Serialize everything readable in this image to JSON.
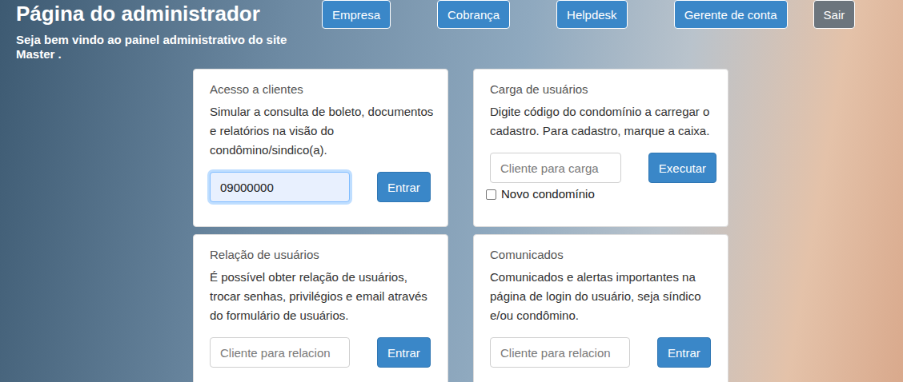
{
  "page": {
    "title": "Página do administrador",
    "subtitle": "Seja bem vindo ao painel administrativo do site Master ."
  },
  "nav": [
    {
      "label": "Empresa",
      "kind": "primary"
    },
    {
      "label": "Cobrança",
      "kind": "primary"
    },
    {
      "label": "Helpdesk",
      "kind": "primary"
    },
    {
      "label": "Gerente de conta",
      "kind": "primary"
    },
    {
      "label": "Sair",
      "kind": "secondary"
    }
  ],
  "cards": [
    {
      "title": "Acesso a clientes",
      "text": "Simular a consulta de boleto, documentos e relatórios na visão do condômino/sindico(a).",
      "field": {
        "value": "09000000",
        "focused": true
      },
      "button": "Entrar"
    },
    {
      "title": "Carga de usuários",
      "text": "Digite código do condomínio a carregar o cadastro. Para cadastro, marque a caixa.",
      "field": {
        "value": "",
        "placeholder": "Cliente para carga",
        "focused": false
      },
      "button": "Executar",
      "checkbox": {
        "label": "Novo condomínio",
        "checked": false
      }
    },
    {
      "title": "Relação de usuários",
      "text": "É possível obter relação de usuários, trocar senhas, privilégios e email através do formulário de usuários.",
      "field": {
        "value": "",
        "placeholder": "Cliente para relacion",
        "focused": false
      },
      "button": "Entrar"
    },
    {
      "title": "Comunicados",
      "text": "Comunicados e alertas importantes na página de login do usuário, seja síndico e/ou condômino.",
      "field": {
        "value": "",
        "placeholder": "Cliente para relacion",
        "focused": false
      },
      "button": "Entrar"
    }
  ]
}
